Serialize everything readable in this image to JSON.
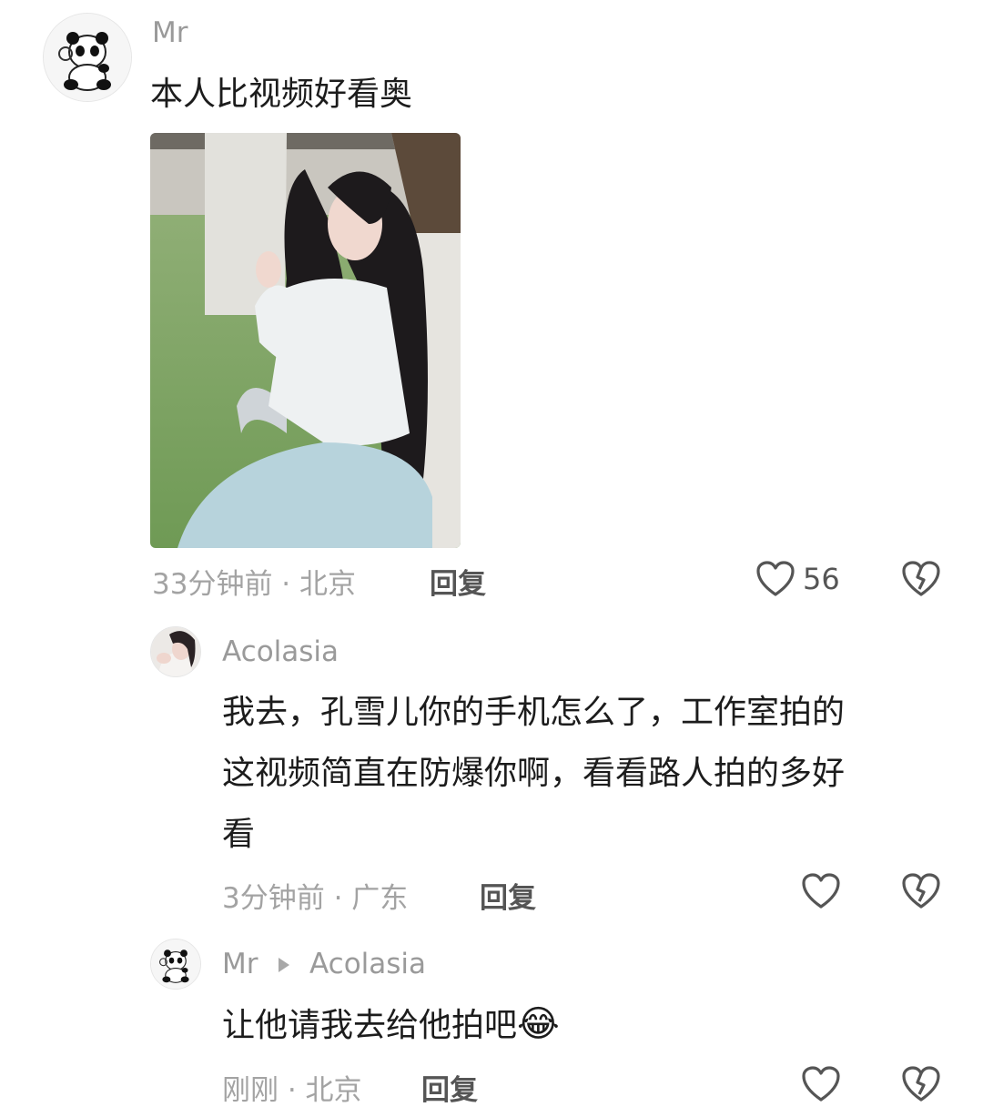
{
  "comment1": {
    "username": "Mr",
    "text": "本人比视频好看奥",
    "time_location": "33分钟前 · 北京",
    "reply_label": "回复",
    "like_count": "56"
  },
  "reply1": {
    "username": "Acolasia",
    "text_line1": "我去，孔雪儿你的手机怎么了，工作室拍的",
    "text_line2": "这视频简直在防爆你啊，看看路人拍的多好",
    "text_line3": "看",
    "time_location": "3分钟前 · 广东",
    "reply_label": "回复"
  },
  "reply2": {
    "username": "Mr",
    "reply_to": "Acolasia",
    "text": "让他请我去给他拍吧",
    "emoji": "😂",
    "time_location": "刚刚 · 北京",
    "reply_label": "回复"
  },
  "colors": {
    "muted_text": "#a3a3a3",
    "username": "#9a9a9a",
    "icon_stroke": "#555555"
  },
  "icons": [
    "panda-avatar",
    "heart-icon",
    "broken-heart-icon",
    "reply-arrow-icon",
    "laughing-emoji"
  ]
}
